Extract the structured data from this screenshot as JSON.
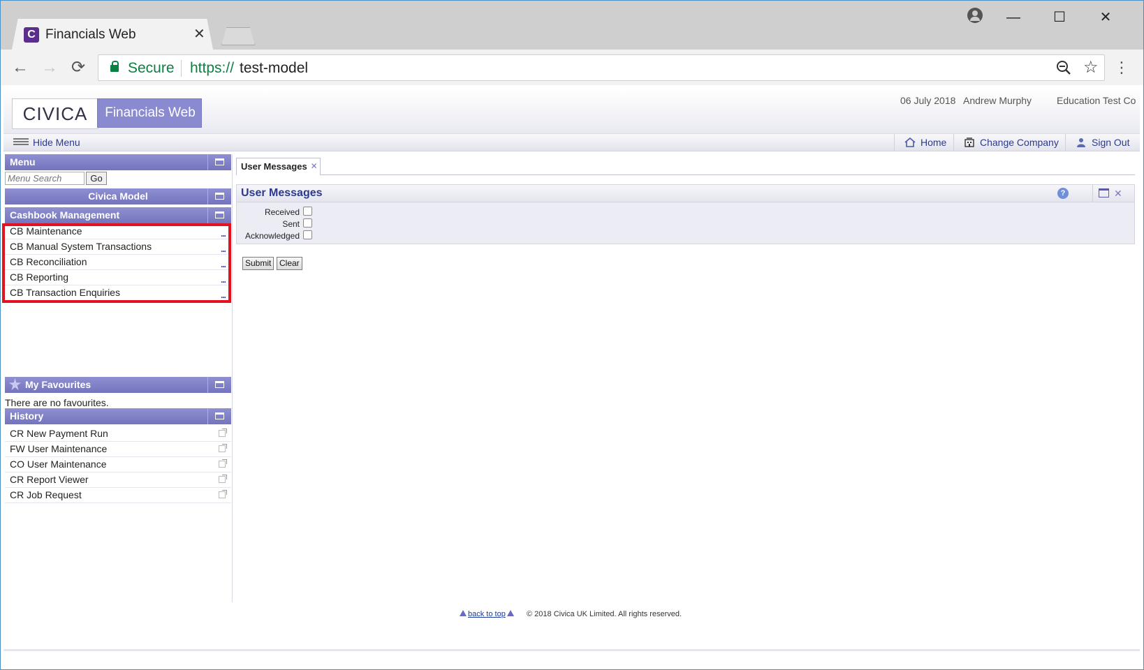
{
  "browser": {
    "tab_title": "Financials Web",
    "tab_favicon_letter": "C",
    "tab_close": "✕",
    "window_controls": {
      "minimize": "—",
      "maximize": "☐",
      "close": "✕"
    },
    "nav": {
      "back": "←",
      "forward": "→",
      "reload": "⟳"
    },
    "security_label": "Secure",
    "url_scheme": "https://",
    "url_host": "test-model",
    "star": "☆",
    "menu": "⋮"
  },
  "header": {
    "logo_text": "CIVICA",
    "product_name": "Financials Web",
    "date": "06 July 2018",
    "user": "Andrew Murphy",
    "company": "Education Test Co"
  },
  "navbar": {
    "hide_menu": "Hide Menu",
    "home": "Home",
    "change_company": "Change Company",
    "sign_out": "Sign Out"
  },
  "sidebar": {
    "menu_title": "Menu",
    "search_placeholder": "Menu Search",
    "go_label": "Go",
    "model_title": "Civica Model",
    "section_title": "Cashbook Management",
    "items": [
      {
        "label": "CB Maintenance",
        "more": "..."
      },
      {
        "label": "CB Manual System Transactions",
        "more": "..."
      },
      {
        "label": "CB Reconciliation",
        "more": "..."
      },
      {
        "label": "CB Reporting",
        "more": "..."
      },
      {
        "label": "CB Transaction Enquiries",
        "more": "..."
      }
    ],
    "favourites_title": "My Favourites",
    "no_favourites": "There are no favourites.",
    "history_title": "History",
    "history": [
      {
        "label": "CR New Payment Run"
      },
      {
        "label": "FW User Maintenance"
      },
      {
        "label": "CO User Maintenance"
      },
      {
        "label": "CR Report Viewer"
      },
      {
        "label": "CR Job Request"
      }
    ]
  },
  "main": {
    "tab_label": "User Messages",
    "tab_close": "✕",
    "panel_title": "User Messages",
    "help": "?",
    "panel_close": "✕",
    "filters": [
      {
        "label": "Received",
        "checked": false
      },
      {
        "label": "Sent",
        "checked": false
      },
      {
        "label": "Acknowledged",
        "checked": false
      }
    ],
    "submit_label": "Submit",
    "clear_label": "Clear"
  },
  "footer": {
    "back_to_top": "back to top",
    "copyright": "© 2018 Civica UK Limited. All rights reserved."
  },
  "colors": {
    "panel_header": "#7f7fc8",
    "link": "#2b3a8c",
    "highlight_box": "#e0141e",
    "secure_green": "#0b8043"
  }
}
